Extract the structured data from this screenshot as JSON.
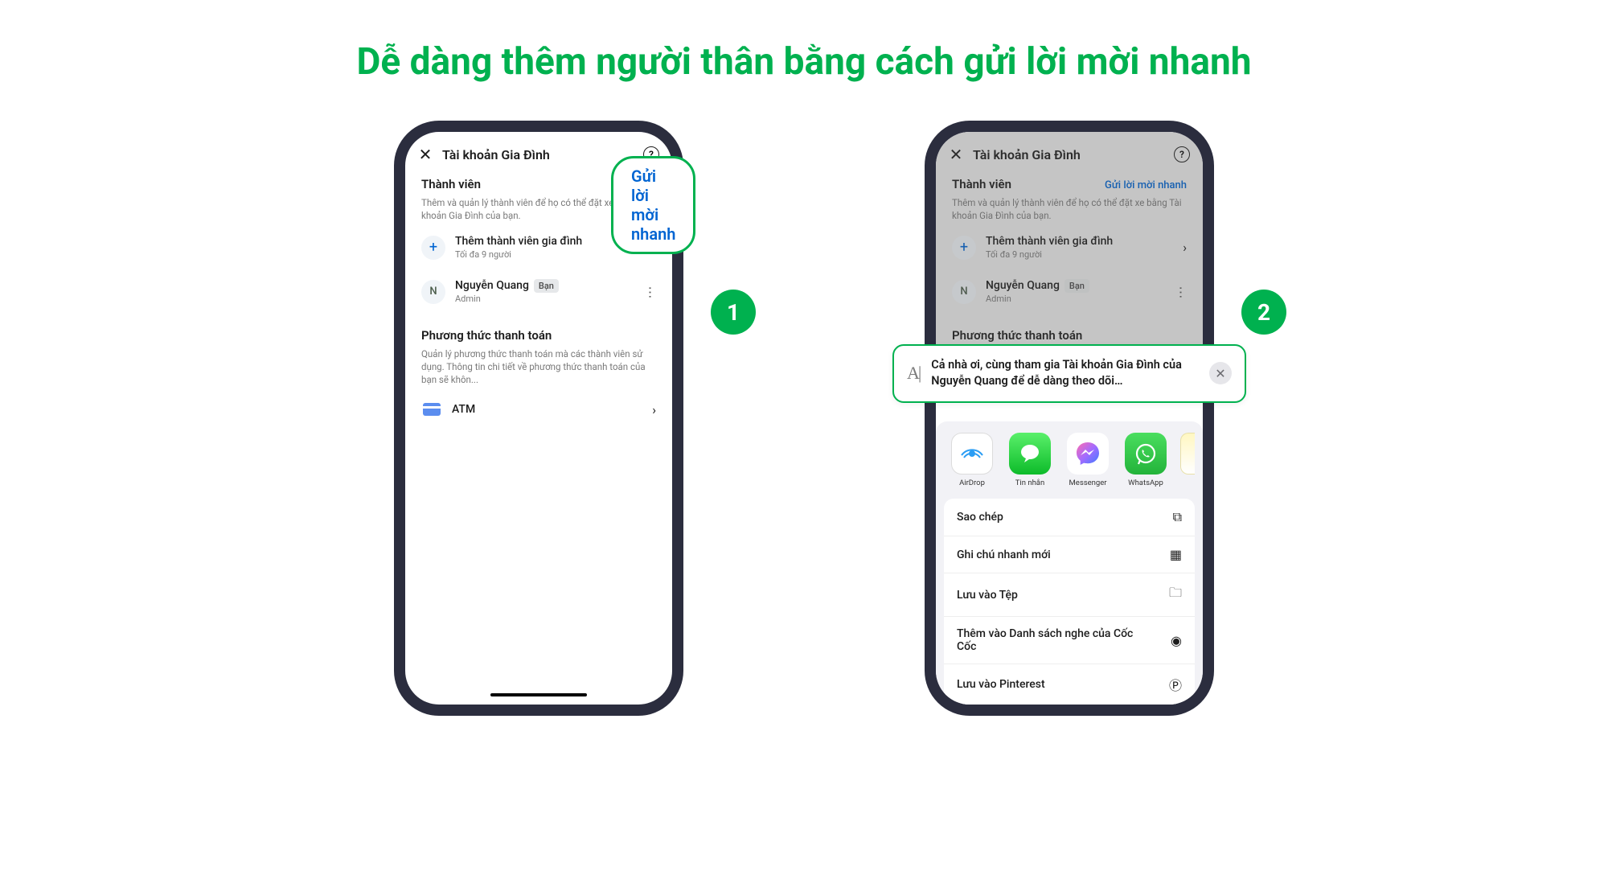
{
  "headline": "Dễ dàng thêm người thân bằng cách gửi lời mời nhanh",
  "callout": "Gửi lời mời nhanh",
  "steps": {
    "one": "1",
    "two": "2"
  },
  "colors": {
    "brand": "#00b14f",
    "link": "#0064d2"
  },
  "screen1": {
    "header_title": "Tài khoản Gia Đình",
    "members_title": "Thành viên",
    "members_desc": "Thêm và quản lý thành viên để họ có thể đặt xe bằng Tài khoản Gia Đình của bạn.",
    "add_title": "Thêm thành viên gia đình",
    "add_sub": "Tối đa 9 người",
    "member_name": "Nguyễn Quang",
    "member_badge": "Bạn",
    "member_role": "Admin",
    "member_initial": "N",
    "pay_title": "Phương thức thanh toán",
    "pay_desc": "Quản lý phương thức thanh toán mà các thành viên sử dụng. Thông tin chi tiết về phương thức thanh toán của bạn sẽ khôn...",
    "pay_method": "ATM"
  },
  "screen2": {
    "header_title": "Tài khoản Gia Đình",
    "quick_link": "Gửi lời mời nhanh",
    "members_title": "Thành viên",
    "members_desc": "Thêm và quản lý thành viên để họ có thể đặt xe bằng Tài khoản Gia Đình của bạn.",
    "add_title": "Thêm thành viên gia đình",
    "add_sub": "Tối đa 9 người",
    "member_name": "Nguyễn Quang",
    "member_badge": "Bạn",
    "member_role": "Admin",
    "member_initial": "N",
    "pay_title": "Phương thức thanh toán",
    "share_text": "Cả nhà ơi, cùng tham gia Tài khoản Gia Đình của Nguyễn Quang để dễ dàng theo dõi…",
    "apps": {
      "airdrop": "AirDrop",
      "messages": "Tin nhắn",
      "messenger": "Messenger",
      "whatsapp": "WhatsApp"
    },
    "actions": {
      "copy": "Sao chép",
      "quicknote": "Ghi chú nhanh mới",
      "savefile": "Lưu vào Tệp",
      "coccoc": "Thêm vào Danh sách nghe của Cốc Cốc",
      "pinterest": "Lưu vào Pinterest"
    }
  }
}
